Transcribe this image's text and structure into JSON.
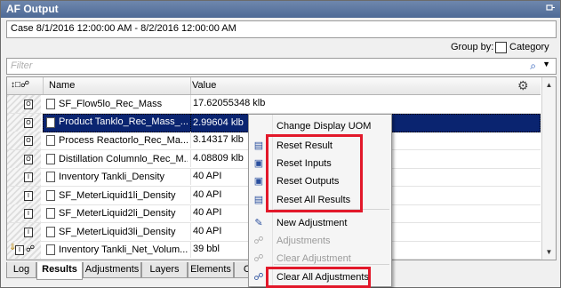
{
  "window": {
    "title": "AF Output"
  },
  "case_range": "Case 8/1/2016 12:00:00 AM  -  8/2/2016 12:00:00 AM",
  "group_by": {
    "label": "Group by:",
    "checkbox_label": "Category",
    "checked": false
  },
  "filter": {
    "placeholder": "Filter"
  },
  "columns": {
    "name": "Name",
    "value": "Value"
  },
  "rows": [
    {
      "icon": "result",
      "name": "SF_Flow5lo_Rec_Mass",
      "value": "17.62055348 klb",
      "selected": false
    },
    {
      "icon": "result",
      "name": "Product Tanklo_Rec_Mass_...",
      "value": "2.99604 klb",
      "selected": true
    },
    {
      "icon": "result",
      "name": "Process Reactorlo_Rec_Ma...",
      "value": "3.14317 klb",
      "selected": false
    },
    {
      "icon": "result",
      "name": "Distillation Columnlo_Rec_M...",
      "value": "4.08809 klb",
      "selected": false
    },
    {
      "icon": "input",
      "name": "Inventory Tankli_Density",
      "value": "40 API",
      "selected": false
    },
    {
      "icon": "input",
      "name": "SF_MeterLiquid1li_Density",
      "value": "40 API",
      "selected": false
    },
    {
      "icon": "input",
      "name": "SF_MeterLiquid2li_Density",
      "value": "40 API",
      "selected": false
    },
    {
      "icon": "input",
      "name": "SF_MeterLiquid3li_Density",
      "value": "40 API",
      "selected": false
    },
    {
      "icon": "adjusted",
      "name": "Inventory Tankli_Net_Volum...",
      "value": "39 bbl",
      "selected": false
    }
  ],
  "tabs": [
    "Log",
    "Results",
    "Adjustments",
    "Layers",
    "Elements",
    "Con"
  ],
  "active_tab": "Results",
  "context_menu": {
    "items": [
      {
        "label": "Change Display UOM",
        "icon": "",
        "disabled": false
      },
      {
        "label": "Reset Result",
        "icon": "reset-result-icon",
        "disabled": false
      },
      {
        "label": "Reset Inputs",
        "icon": "reset-inputs-icon",
        "disabled": false
      },
      {
        "label": "Reset Outputs",
        "icon": "reset-outputs-icon",
        "disabled": false
      },
      {
        "label": "Reset All Results",
        "icon": "reset-all-icon",
        "disabled": false
      },
      {
        "label": "New Adjustment",
        "icon": "new-adjustment-icon",
        "disabled": false
      },
      {
        "label": "Adjustments",
        "icon": "adjustments-icon",
        "disabled": true
      },
      {
        "label": "Clear Adjustment",
        "icon": "clear-adjustment-icon",
        "disabled": true
      },
      {
        "label": "Clear All Adjustments",
        "icon": "clear-all-adjustments-icon",
        "disabled": false
      }
    ]
  },
  "highlight_color": "#e2182a"
}
